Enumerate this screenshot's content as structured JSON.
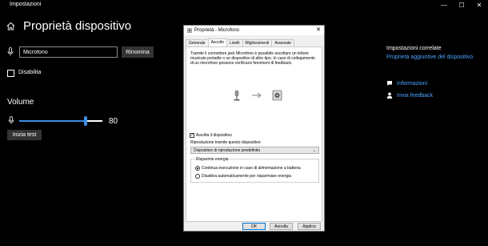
{
  "window": {
    "title": "Impostazioni",
    "minimize": "—",
    "maximize": "☐",
    "close": "✕"
  },
  "page": {
    "title": "Proprietà dispositivo",
    "device_name_value": "Microfono",
    "rename_label": "Rinomina",
    "disable_label": "Disabilita",
    "volume_heading": "Volume",
    "volume_value": "80",
    "volume_level": 0.8,
    "test_label": "Inizia test"
  },
  "related": {
    "heading": "Impostazioni correlate",
    "link": "Proprietà aggiuntive del dispositivo",
    "info_label": "Informazioni",
    "feedback_label": "Invia feedback"
  },
  "dialog": {
    "title": "Proprietà - Microfono",
    "close": "✕",
    "tabs": [
      "Generale",
      "Ascolto",
      "Livelli",
      "Miglioramenti",
      "Avanzate"
    ],
    "description": "Tramite il connettore jack Microfono è possibile ascoltare un lettore musicale portatile o un dispositivo di altro tipo. In caso di collegamento di un microfono possono verificarsi fenomeni di feedback.",
    "listen_label": "Ascolta il dispositivo",
    "playback_label": "Riproduzione tramite questo dispositivo:",
    "playback_value": "Dispositivo di riproduzione predefinito",
    "power_label": "Risparmio energia",
    "radio_continue": "Continua esecuzione in caso di alimentazione a batteria",
    "radio_disable": "Disattiva automaticamente per risparmiare energia",
    "ok": "OK",
    "cancel": "Annulla",
    "apply": "Applica"
  },
  "colors": {
    "accent": "#3a8ee6",
    "link": "#4aa3ff"
  }
}
